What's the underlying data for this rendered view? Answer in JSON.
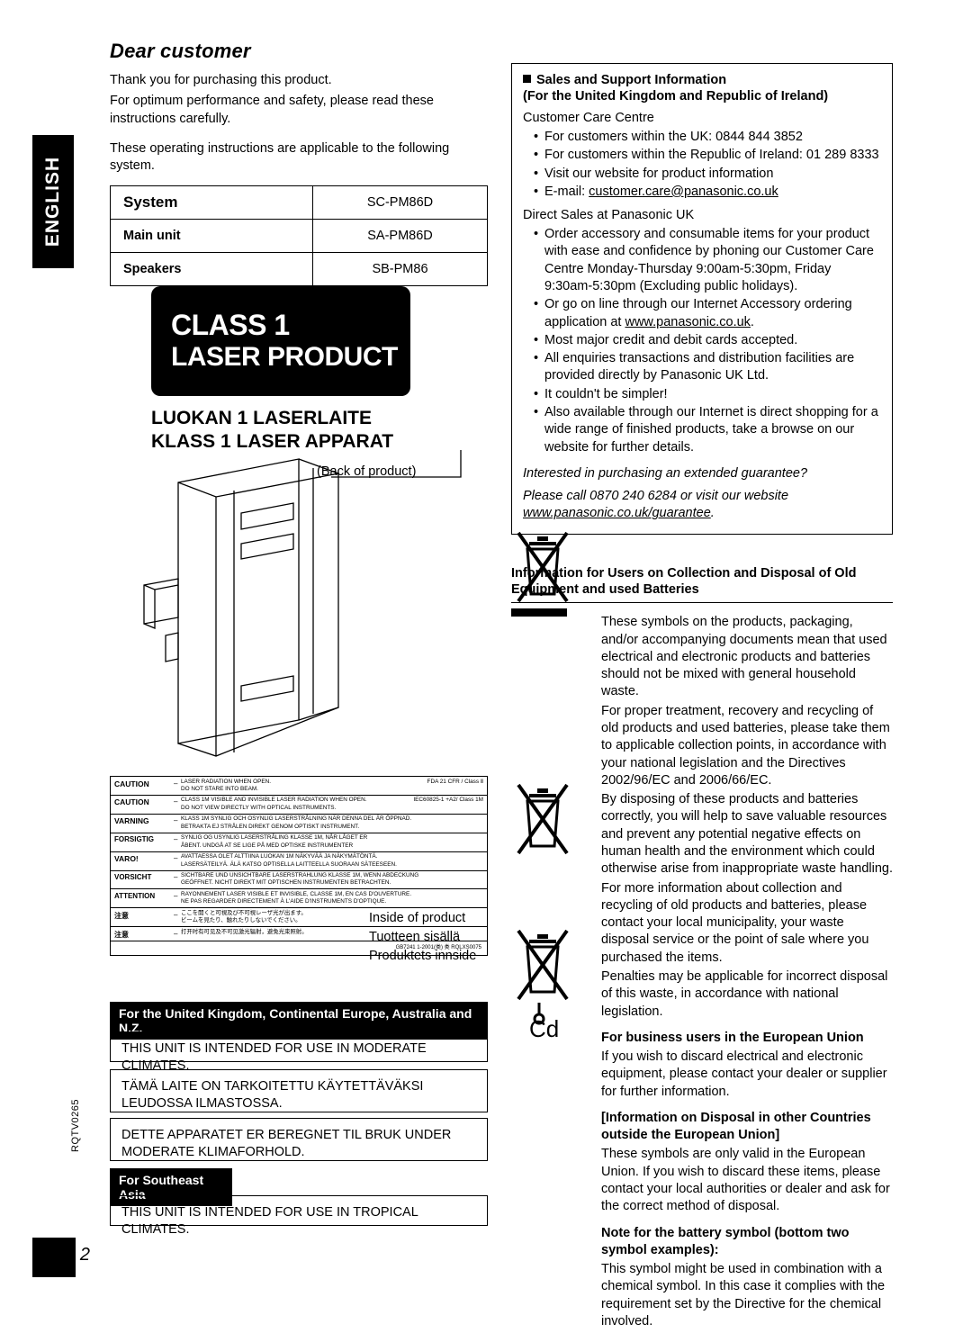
{
  "language_tab": "ENGLISH",
  "page_number": "2",
  "doc_code": "RQTV0265",
  "left": {
    "title": "Dear customer",
    "para1": "Thank you for purchasing this product.",
    "para2": "For optimum performance and safety, please read these instructions carefully.",
    "para3": "These operating instructions are applicable to the following system.",
    "system_table": {
      "rows": [
        {
          "label": "System",
          "value": "SC-PM86D"
        },
        {
          "label": "Main unit",
          "value": "SA-PM86D"
        },
        {
          "label": "Speakers",
          "value": "SB-PM86"
        }
      ]
    },
    "laser_box": {
      "line1": "CLASS 1",
      "line2": "LASER PRODUCT"
    },
    "luokan": "LUOKAN 1 LASERLAITE\nKLASS 1 LASER APPARAT",
    "luokan_l1": "LUOKAN 1 LASERLAITE",
    "luokan_l2": "KLASS 1 LASER APPARAT",
    "back_of_product": "(Back of product)",
    "caution_label": {
      "rows": [
        {
          "tag": "CAUTION",
          "text": "LASER RADIATION WHEN OPEN.\nDO NOT STARE INTO BEAM.",
          "right": "FDA 21 CFR / Class Ⅱ"
        },
        {
          "tag": "CAUTION",
          "text": "CLASS 1M VISIBLE AND INVISIBLE LASER RADIATION WHEN OPEN.\nDO NOT VIEW DIRECTLY WITH OPTICAL INSTRUMENTS.",
          "right": "IEC60825-1 +A2/ Class 1M"
        },
        {
          "tag": "VARNING",
          "text": "KLASS 1M SYNLIG OCH OSYNLIG LASERSTRÅLNING NÄR DENNA DEL ÄR ÖPPNAD.\nBETRAKTA EJ STRÅLEN DIREKT GENOM OPTISKT INSTRUMENT.",
          "right": ""
        },
        {
          "tag": "FORSIGTIG",
          "text": "SYNLIG OG USYNLIG LASERSTRÅLING KLASSE 1M, NÅR LÅGET ER\nÅBENT.  UNDGÅ AT SE LIGE PÅ MED OPTISKE INSTRUMENTER",
          "right": ""
        },
        {
          "tag": "VARO!",
          "text": "AVATTAESSA OLET ALTTIINA LUOKAN 1M NÄKYVÄÄ JA NÄKYMÄTÖNTÄ.\nLASERSÄTEILYÄ.  ÄLÄ KATSO OPTISELLA LAITTEELLA SUORAAN SÄTEESEEN.",
          "right": ""
        },
        {
          "tag": "VORSICHT",
          "text": "SICHTBARE UND UNSICHTBARE LASERSTRAHLUNG KLASSE 1M, WENN ABDECKUNG\nGEÖFFNET.  NICHT DIREKT MIT OPTISCHEN INSTRUMENTEN BETRACHTEN.",
          "right": ""
        },
        {
          "tag": "ATTENTION",
          "text": "RAYONNEMENT LASER VISIBLE ET INVISIBLE, CLASSE 1M, EN CAS D'OUVERTURE.\nNE PAS REGARDER DIRECTEMENT À L'AIDE D'INSTRUMENTS D'OPTIQUE.",
          "right": ""
        },
        {
          "tag": "注意",
          "text": "ここを開くと可視及び不可視レーザ光が出ます。\nビームを見たり、触れたりしないでください。",
          "right": ""
        },
        {
          "tag": "注意",
          "text": "打开时有可见及不可见激光辐射，避免光束照射。",
          "right": ""
        }
      ],
      "footer": "GB7241  1-2001(类)  类                                   RQLXS0075"
    },
    "inside_of_product": "Inside of product\nTuotteen sisällä\nProduktets innside",
    "inside_l1": "Inside of product",
    "inside_l2": "Tuotteen sisällä",
    "inside_l3": "Produktets innside",
    "region_header": "For the United Kingdom, Continental Europe, Australia and N.Z.",
    "box1": "THIS UNIT IS INTENDED FOR USE IN MODERATE CLIMATES.",
    "box2": "TÄMÄ LAITE ON TARKOITETTU KÄYTETTÄVÄKSI LEUDOSSA ILMASTOSSA.",
    "box3": "DETTE APPARATET ER BEREGNET TIL BRUK UNDER MODERATE KLIMAFORHOLD.",
    "sea_header": "For Southeast Asia",
    "box4": "THIS UNIT IS INTENDED FOR USE IN TROPICAL CLIMATES."
  },
  "right": {
    "sales": {
      "heading": "Sales and Support Information",
      "subheading": "(For the United Kingdom and Republic of Ireland)",
      "care_centre": "Customer Care Centre",
      "care_items": [
        "For customers within the UK: 0844 844 3852",
        "For customers within the Republic of Ireland: 01 289 8333",
        "Visit our website for product information",
        "E-mail: customer.care@panasonic.co.uk"
      ],
      "email_link": "customer.care@panasonic.co.uk",
      "direct_sales": "Direct Sales at Panasonic UK",
      "direct_items": [
        "Order accessory and consumable items for your product with ease and confidence by phoning our Customer Care Centre Monday-Thursday 9:00am-5:30pm, Friday 9:30am-5:30pm (Excluding public holidays).",
        "Or go on line through our Internet Accessory ordering application at www.panasonic.co.uk.",
        "Most major credit and debit cards accepted.",
        "All enquiries transactions and distribution facilities are provided directly by Panasonic UK Ltd.",
        "It couldn't be simpler!",
        "Also available through our Internet is direct shopping for a wide range of finished products, take a browse on our website for further details."
      ],
      "website_link": "www.panasonic.co.uk",
      "guarantee_1": "Interested in purchasing an extended guarantee?",
      "guarantee_2": "Please call 0870 240 6284 or visit our website",
      "guarantee_link": "www.panasonic.co.uk/guarantee",
      "guarantee_period": "."
    },
    "disposal": {
      "heading": "Information for Users on Collection and Disposal of Old Equipment and used Batteries",
      "para1": "These symbols on the products, packaging, and/or accompanying documents mean that used electrical and electronic products and batteries should not be mixed with general household waste.",
      "para2": "For proper treatment, recovery and recycling of old products and used batteries, please take them to applicable collection points, in accordance with your national legislation and the Directives 2002/96/EC and 2006/66/EC.",
      "para3": "By disposing of these products and batteries correctly, you will help to save valuable resources and prevent any potential negative effects on human health and the environment which could otherwise arise from inappropriate waste handling.",
      "para4": "For more information about collection and recycling of old products and batteries, please contact your local municipality, your waste disposal service or the point of sale where you purchased the items.",
      "para5": "Penalties may be applicable for incorrect disposal of this waste, in accordance with national legislation.",
      "business_head": "For business users in the European Union",
      "business_body": "If you wish to discard electrical and electronic equipment, please contact your dealer or supplier for further information.",
      "other_head": "[Information on Disposal in other Countries outside the European Union]",
      "other_body": "These symbols are only valid in the European Union. If you wish to discard these items, please contact your local authorities or dealer and ask for the correct method of disposal.",
      "battery_head": "Note for the battery symbol (bottom two symbol examples):",
      "battery_body": "This symbol might be used in combination with a chemical symbol. In this case it complies with the requirement set by the Directive for the chemical involved.",
      "cd_label": "Cd"
    }
  }
}
